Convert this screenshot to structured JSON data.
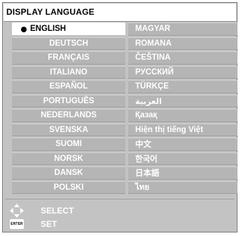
{
  "menu": {
    "title": "DISPLAY LANGUAGE",
    "selected": "ENGLISH",
    "left_column": [
      "ENGLISH",
      "DEUTSCH",
      "FRANÇAIS",
      "ITALIANO",
      "ESPAÑOL",
      "PORTUGUÊS",
      "NEDERLANDS",
      "SVENSKA",
      "SUOMI",
      "NORSK",
      "DANSK",
      "POLSKI"
    ],
    "right_column": [
      "MAGYAR",
      "ROMANA",
      "ČEŠTINA",
      "РУССКИЙ",
      "TÜRKÇE",
      "العربية",
      "Қазақ",
      "Hiện thị tiếng Việt",
      "中文",
      "한국어",
      "日本語",
      "ไทย"
    ]
  },
  "guide": {
    "select_label": "SELECT",
    "set_label": "SET",
    "enter_key": "ENTER",
    "select_icon": "arrow-cross-icon",
    "enter_icon": "enter-key-icon"
  },
  "colors": {
    "panel": "#c3c3c3",
    "item": "#b5b5b5",
    "selected_item": "#ffffff",
    "text": "#ffffff"
  }
}
